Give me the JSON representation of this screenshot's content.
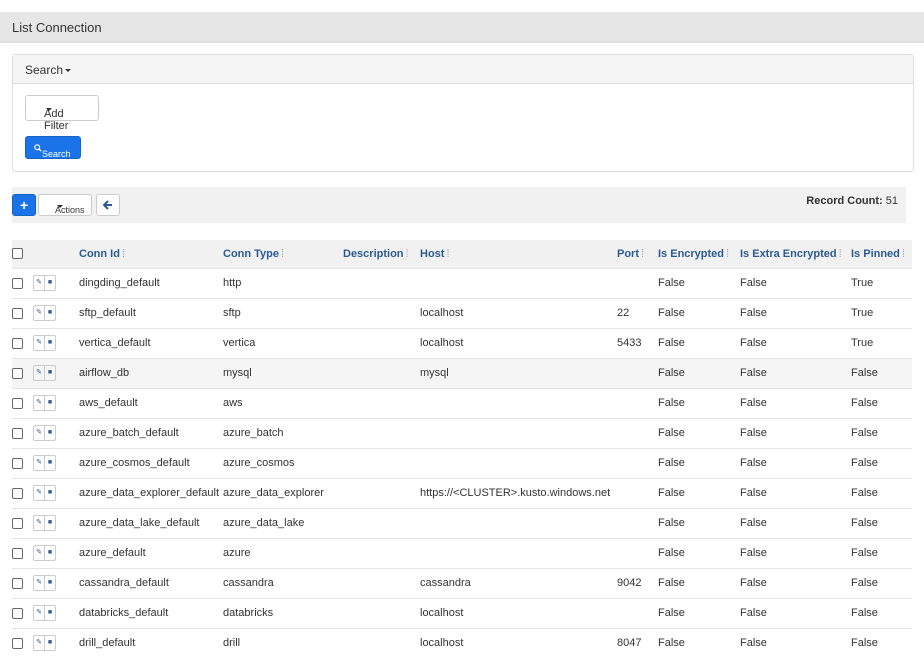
{
  "page": {
    "title": "List Connection"
  },
  "search": {
    "header_label": "Search",
    "add_filter_label": "Add Filter",
    "search_button_label": "Search"
  },
  "toolbar": {
    "add_label": "+",
    "actions_label": "Actions",
    "record_count_label": "Record Count:",
    "record_count_value": "51"
  },
  "icons": {
    "search": "search-icon",
    "back": "arrow-left-icon",
    "edit": "edit-icon",
    "delete": "trash-icon"
  },
  "colors": {
    "primary": "#1a73e8",
    "header_link": "#2c5a93"
  },
  "table": {
    "columns": [
      "Conn Id",
      "Conn Type",
      "Description",
      "Host",
      "Port",
      "Is Encrypted",
      "Is Extra Encrypted",
      "Is Pinned"
    ],
    "rows": [
      [
        "dingding_default",
        "http",
        "",
        "",
        "",
        "False",
        "False",
        "True"
      ],
      [
        "sftp_default",
        "sftp",
        "",
        "localhost",
        "22",
        "False",
        "False",
        "True"
      ],
      [
        "vertica_default",
        "vertica",
        "",
        "localhost",
        "5433",
        "False",
        "False",
        "True"
      ],
      [
        "airflow_db",
        "mysql",
        "",
        "mysql",
        "",
        "False",
        "False",
        "False"
      ],
      [
        "aws_default",
        "aws",
        "",
        "",
        "",
        "False",
        "False",
        "False"
      ],
      [
        "azure_batch_default",
        "azure_batch",
        "",
        "",
        "",
        "False",
        "False",
        "False"
      ],
      [
        "azure_cosmos_default",
        "azure_cosmos",
        "",
        "",
        "",
        "False",
        "False",
        "False"
      ],
      [
        "azure_data_explorer_default",
        "azure_data_explorer",
        "",
        "https://<CLUSTER>.kusto.windows.net",
        "",
        "False",
        "False",
        "False"
      ],
      [
        "azure_data_lake_default",
        "azure_data_lake",
        "",
        "",
        "",
        "False",
        "False",
        "False"
      ],
      [
        "azure_default",
        "azure",
        "",
        "",
        "",
        "False",
        "False",
        "False"
      ],
      [
        "cassandra_default",
        "cassandra",
        "",
        "cassandra",
        "9042",
        "False",
        "False",
        "False"
      ],
      [
        "databricks_default",
        "databricks",
        "",
        "localhost",
        "",
        "False",
        "False",
        "False"
      ],
      [
        "drill_default",
        "drill",
        "",
        "localhost",
        "8047",
        "False",
        "False",
        "False"
      ]
    ]
  }
}
